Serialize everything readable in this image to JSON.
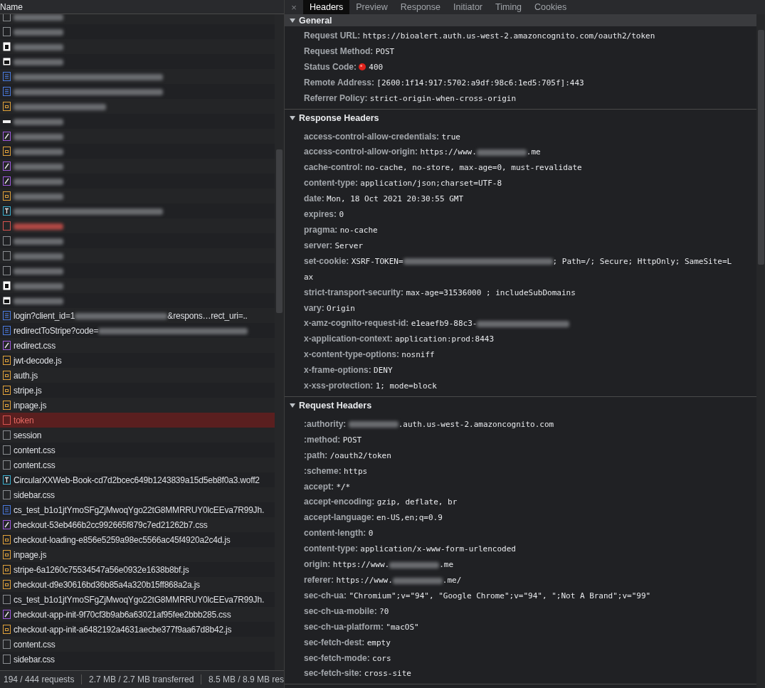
{
  "requests": {
    "column": "Name",
    "rows": [
      {
        "kind": "blank",
        "parts": [
          {
            "kind": "blur"
          }
        ],
        "error": false,
        "selected": false
      },
      {
        "kind": "blank",
        "parts": [
          {
            "kind": "blur"
          }
        ],
        "error": false,
        "selected": false
      },
      {
        "kind": "imagelight",
        "parts": [
          {
            "kind": "blur"
          }
        ],
        "error": false,
        "selected": false
      },
      {
        "kind": "imagedark",
        "parts": [
          {
            "kind": "blur"
          }
        ],
        "error": false,
        "selected": false
      },
      {
        "kind": "doc",
        "parts": [
          {
            "kind": "longblur"
          }
        ],
        "error": false,
        "selected": false
      },
      {
        "kind": "doc",
        "parts": [
          {
            "kind": "longblur"
          }
        ],
        "error": false,
        "selected": false
      },
      {
        "kind": "script",
        "parts": [
          {
            "kind": "midblur"
          }
        ],
        "error": false,
        "selected": false
      },
      {
        "kind": "dash",
        "parts": [
          {
            "kind": "blur"
          }
        ],
        "error": false,
        "selected": false
      },
      {
        "kind": "style",
        "parts": [
          {
            "kind": "blur"
          }
        ],
        "error": false,
        "selected": false
      },
      {
        "kind": "script",
        "parts": [
          {
            "kind": "blur"
          }
        ],
        "error": false,
        "selected": false
      },
      {
        "kind": "style",
        "parts": [
          {
            "kind": "blur"
          }
        ],
        "error": false,
        "selected": false
      },
      {
        "kind": "style",
        "parts": [
          {
            "kind": "blur"
          }
        ],
        "error": false,
        "selected": false
      },
      {
        "kind": "script",
        "parts": [
          {
            "kind": "blur"
          }
        ],
        "error": false,
        "selected": false
      },
      {
        "kind": "font",
        "parts": [
          {
            "kind": "longblur"
          }
        ],
        "error": false,
        "selected": false
      },
      {
        "kind": "blank",
        "parts": [
          {
            "kind": "blur"
          }
        ],
        "error": true,
        "selected": false
      },
      {
        "kind": "blank",
        "parts": [
          {
            "kind": "blur"
          }
        ],
        "error": false,
        "selected": false
      },
      {
        "kind": "blank",
        "parts": [
          {
            "kind": "blur"
          }
        ],
        "error": false,
        "selected": false
      },
      {
        "kind": "blank",
        "parts": [
          {
            "kind": "blur"
          }
        ],
        "error": false,
        "selected": false
      },
      {
        "kind": "imagelight",
        "parts": [
          {
            "kind": "blur"
          }
        ],
        "error": false,
        "selected": false
      },
      {
        "kind": "imagedark",
        "parts": [
          {
            "kind": "blur"
          }
        ],
        "error": false,
        "selected": false
      },
      {
        "kind": "doc",
        "parts": [
          {
            "text": "login?client_id=1"
          },
          {
            "kind": "midblur"
          },
          {
            "text": "&respons…rect_uri=.."
          }
        ],
        "error": false,
        "selected": false
      },
      {
        "kind": "doc",
        "parts": [
          {
            "text": "redirectToStripe?code="
          },
          {
            "kind": "longblur"
          }
        ],
        "error": false,
        "selected": false
      },
      {
        "kind": "style",
        "parts": [
          {
            "text": "redirect.css"
          }
        ],
        "error": false,
        "selected": false
      },
      {
        "kind": "script",
        "parts": [
          {
            "text": "jwt-decode.js"
          }
        ],
        "error": false,
        "selected": false
      },
      {
        "kind": "script",
        "parts": [
          {
            "text": "auth.js"
          }
        ],
        "error": false,
        "selected": false
      },
      {
        "kind": "script",
        "parts": [
          {
            "text": "stripe.js"
          }
        ],
        "error": false,
        "selected": false
      },
      {
        "kind": "script",
        "parts": [
          {
            "text": "inpage.js"
          }
        ],
        "error": false,
        "selected": false
      },
      {
        "kind": "blank",
        "parts": [
          {
            "text": "token"
          }
        ],
        "error": true,
        "selected": true
      },
      {
        "kind": "blank",
        "parts": [
          {
            "text": "session"
          }
        ],
        "error": false,
        "selected": false
      },
      {
        "kind": "blank",
        "parts": [
          {
            "text": "content.css"
          }
        ],
        "error": false,
        "selected": false
      },
      {
        "kind": "blank",
        "parts": [
          {
            "text": "content.css"
          }
        ],
        "error": false,
        "selected": false
      },
      {
        "kind": "font",
        "parts": [
          {
            "text": "CircularXXWeb-Book-cd7d2bcec649b1243839a15d5eb8f0a3.woff2"
          }
        ],
        "error": false,
        "selected": false
      },
      {
        "kind": "blank",
        "parts": [
          {
            "text": "sidebar.css"
          }
        ],
        "error": false,
        "selected": false
      },
      {
        "kind": "doc",
        "parts": [
          {
            "text": "cs_test_b1o1jtYmoSFgZjMwoqYgo22tG8MMRRUY0lcEEva7R99Jh."
          }
        ],
        "error": false,
        "selected": false
      },
      {
        "kind": "style",
        "parts": [
          {
            "text": "checkout-53eb466b2cc992665f879c7ed21262b7.css"
          }
        ],
        "error": false,
        "selected": false
      },
      {
        "kind": "script",
        "parts": [
          {
            "text": "checkout-loading-e856e5259a98ec5566ac45f4920a2c4d.js"
          }
        ],
        "error": false,
        "selected": false
      },
      {
        "kind": "script",
        "parts": [
          {
            "text": "inpage.js"
          }
        ],
        "error": false,
        "selected": false
      },
      {
        "kind": "script",
        "parts": [
          {
            "text": "stripe-6a1260c75534547a56e0932e1638b8bf.js"
          }
        ],
        "error": false,
        "selected": false
      },
      {
        "kind": "script",
        "parts": [
          {
            "text": "checkout-d9e30616bd36b85a4a320b15ff868a2a.js"
          }
        ],
        "error": false,
        "selected": false
      },
      {
        "kind": "blank",
        "parts": [
          {
            "text": "cs_test_b1o1jtYmoSFgZjMwoqYgo22tG8MMRRUY0lcEEva7R99Jh."
          }
        ],
        "error": false,
        "selected": false
      },
      {
        "kind": "style",
        "parts": [
          {
            "text": "checkout-app-init-9f70cf3b9ab6a63021af95fee2bbb285.css"
          }
        ],
        "error": false,
        "selected": false
      },
      {
        "kind": "script",
        "parts": [
          {
            "text": "checkout-app-init-a6482192a4631aecbe377f9aa67d8b42.js"
          }
        ],
        "error": false,
        "selected": false
      },
      {
        "kind": "blank",
        "parts": [
          {
            "text": "content.css"
          }
        ],
        "error": false,
        "selected": false
      },
      {
        "kind": "blank",
        "parts": [
          {
            "text": "sidebar.css"
          }
        ],
        "error": false,
        "selected": false
      }
    ]
  },
  "status_bar": [
    "194 / 444 requests",
    "2.7 MB / 2.7 MB transferred",
    "8.5 MB / 8.9 MB res"
  ],
  "close": "×",
  "tabs": [
    {
      "label": "Headers",
      "selected": true
    },
    {
      "label": "Preview",
      "selected": false
    },
    {
      "label": "Response",
      "selected": false
    },
    {
      "label": "Initiator",
      "selected": false
    },
    {
      "label": "Timing",
      "selected": false
    },
    {
      "label": "Cookies",
      "selected": false
    }
  ],
  "sections": [
    {
      "title": "General",
      "expanded": true,
      "highlighted": true,
      "rows": [
        {
          "key": "Request URL:",
          "value": [
            {
              "text": "https://bioalert.auth.us-west-2.amazoncognito.com/oauth2/token"
            }
          ]
        },
        {
          "key": "Request Method:",
          "value": [
            {
              "text": "POST"
            }
          ]
        },
        {
          "key": "Status Code:",
          "kind": "errorstatus",
          "value": [
            {
              "text": "400"
            }
          ]
        },
        {
          "key": "Remote Address:",
          "value": [
            {
              "text": "[2600:1f14:917:5702:a9df:98c6:1ed5:705f]:443"
            }
          ]
        },
        {
          "key": "Referrer Policy:",
          "value": [
            {
              "text": "strict-origin-when-cross-origin"
            }
          ]
        }
      ]
    },
    {
      "title": "Response Headers",
      "expanded": true,
      "highlighted": false,
      "rows": [
        {
          "key": "access-control-allow-credentials:",
          "value": [
            {
              "text": "true"
            }
          ]
        },
        {
          "key": "access-control-allow-origin:",
          "value": [
            {
              "text": "https://www."
            },
            {
              "kind": "blur"
            },
            {
              "text": ".me"
            }
          ]
        },
        {
          "key": "cache-control:",
          "value": [
            {
              "text": "no-cache, no-store, max-age=0, must-revalidate"
            }
          ]
        },
        {
          "key": "content-type:",
          "value": [
            {
              "text": "application/json;charset=UTF-8"
            }
          ]
        },
        {
          "key": "date:",
          "value": [
            {
              "text": "Mon, 18 Oct 2021 20:30:55 GMT"
            }
          ]
        },
        {
          "key": "expires:",
          "value": [
            {
              "text": "0"
            }
          ]
        },
        {
          "key": "pragma:",
          "value": [
            {
              "text": "no-cache"
            }
          ]
        },
        {
          "key": "server:",
          "value": [
            {
              "text": "Server"
            }
          ]
        },
        {
          "key": "set-cookie:",
          "value": [
            {
              "text": "XSRF-TOKEN="
            },
            {
              "kind": "longblur"
            },
            {
              "text": "; Path=/; Secure; HttpOnly; SameSite=L"
            },
            {
              "kind": "newline"
            },
            {
              "text": "ax"
            }
          ]
        },
        {
          "key": "strict-transport-security:",
          "value": [
            {
              "text": "max-age=31536000 ; includeSubDomains"
            }
          ]
        },
        {
          "key": "vary:",
          "value": [
            {
              "text": "Origin"
            }
          ]
        },
        {
          "key": "x-amz-cognito-request-id:",
          "value": [
            {
              "text": "e1eaefb9-88c3-"
            },
            {
              "kind": "midblur"
            }
          ]
        },
        {
          "key": "x-application-context:",
          "value": [
            {
              "text": "application:prod:8443"
            }
          ]
        },
        {
          "key": "x-content-type-options:",
          "value": [
            {
              "text": "nosniff"
            }
          ]
        },
        {
          "key": "x-frame-options:",
          "value": [
            {
              "text": "DENY"
            }
          ]
        },
        {
          "key": "x-xss-protection:",
          "value": [
            {
              "text": "1; mode=block"
            }
          ]
        }
      ]
    },
    {
      "title": "Request Headers",
      "expanded": true,
      "highlighted": false,
      "rows": [
        {
          "key": ":authority:",
          "value": [
            {
              "kind": "blur"
            },
            {
              "text": ".auth.us-west-2.amazoncognito.com"
            }
          ]
        },
        {
          "key": ":method:",
          "value": [
            {
              "text": "POST"
            }
          ]
        },
        {
          "key": ":path:",
          "value": [
            {
              "text": "/oauth2/token"
            }
          ]
        },
        {
          "key": ":scheme:",
          "value": [
            {
              "text": "https"
            }
          ]
        },
        {
          "key": "accept:",
          "value": [
            {
              "text": "*/*"
            }
          ]
        },
        {
          "key": "accept-encoding:",
          "value": [
            {
              "text": "gzip, deflate, br"
            }
          ]
        },
        {
          "key": "accept-language:",
          "value": [
            {
              "text": "en-US,en;q=0.9"
            }
          ]
        },
        {
          "key": "content-length:",
          "value": [
            {
              "text": "0"
            }
          ]
        },
        {
          "key": "content-type:",
          "value": [
            {
              "text": "application/x-www-form-urlencoded"
            }
          ]
        },
        {
          "key": "origin:",
          "value": [
            {
              "text": "https://www."
            },
            {
              "kind": "blur"
            },
            {
              "text": ".me"
            }
          ]
        },
        {
          "key": "referer:",
          "value": [
            {
              "text": "https://www."
            },
            {
              "kind": "blur"
            },
            {
              "text": ".me/"
            }
          ]
        },
        {
          "key": "sec-ch-ua:",
          "value": [
            {
              "text": "\"Chromium\";v=\"94\", \"Google Chrome\";v=\"94\", \";Not A Brand\";v=\"99\""
            }
          ]
        },
        {
          "key": "sec-ch-ua-mobile:",
          "value": [
            {
              "text": "?0"
            }
          ]
        },
        {
          "key": "sec-ch-ua-platform:",
          "value": [
            {
              "text": "\"macOS\""
            }
          ]
        },
        {
          "key": "sec-fetch-dest:",
          "value": [
            {
              "text": "empty"
            }
          ]
        },
        {
          "key": "sec-fetch-mode:",
          "value": [
            {
              "text": "cors"
            }
          ]
        },
        {
          "key": "sec-fetch-site:",
          "value": [
            {
              "text": "cross-site"
            }
          ]
        }
      ]
    }
  ]
}
